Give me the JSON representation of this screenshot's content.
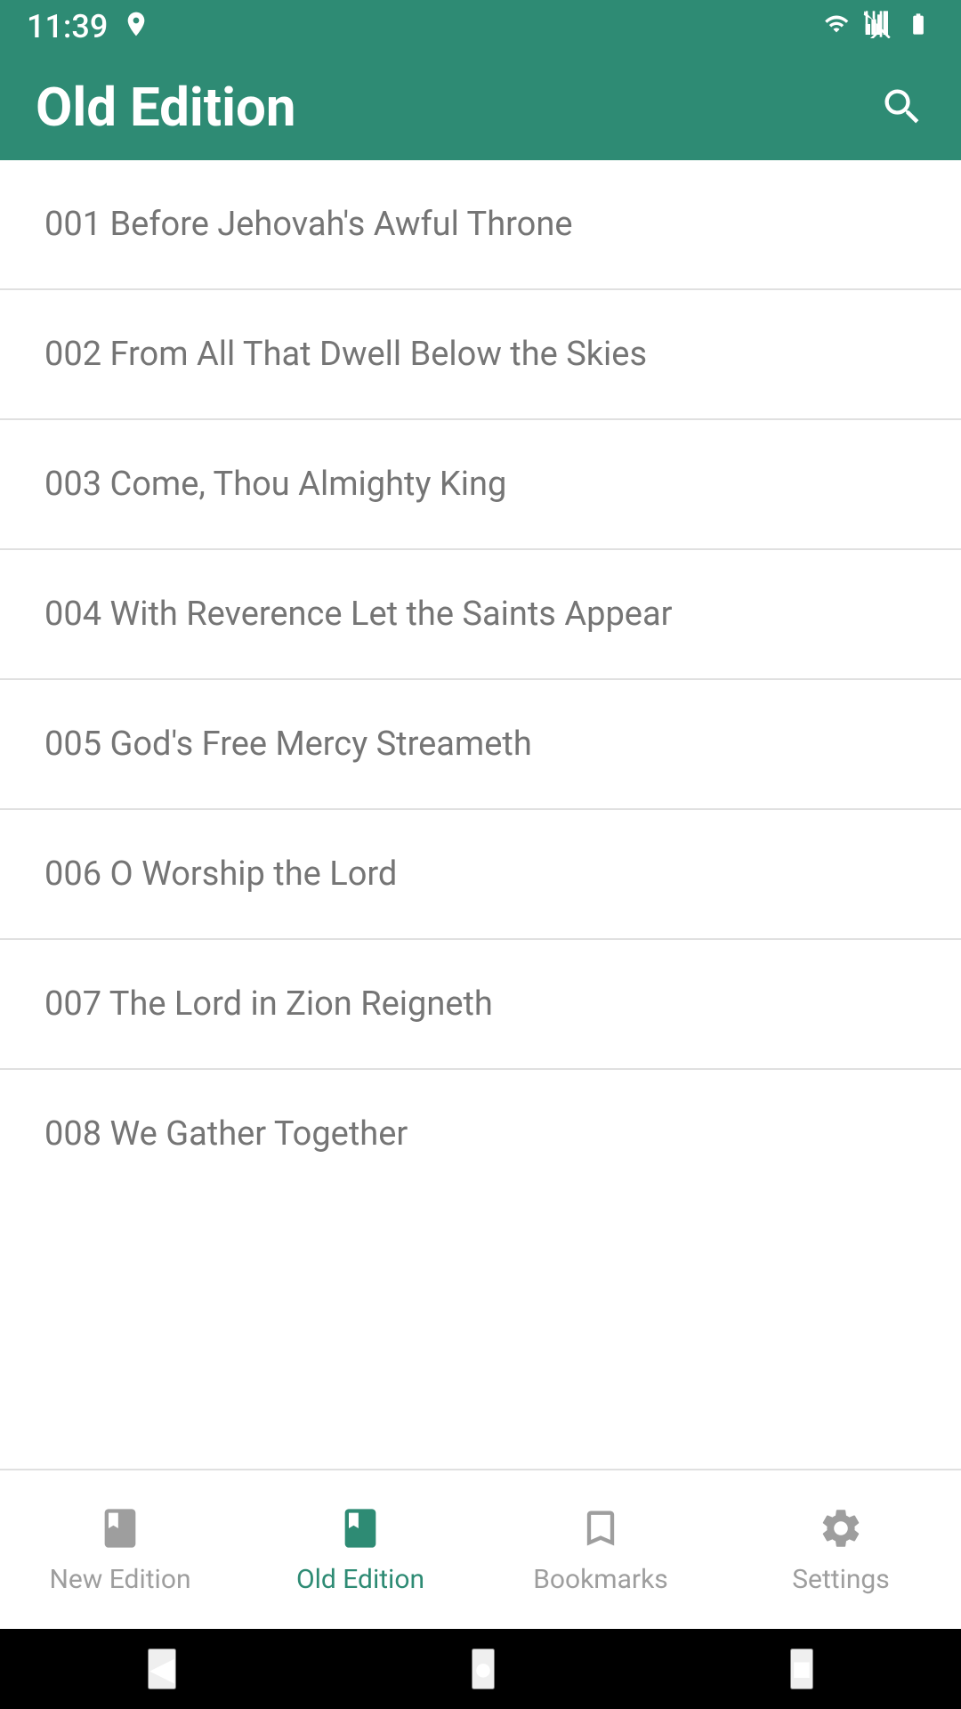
{
  "status": {
    "time": "11:39",
    "icons": [
      "person-pin-icon",
      "wifi-icon",
      "signal-icon",
      "battery-icon"
    ]
  },
  "header": {
    "title": "Old Edition",
    "search_label": "Search"
  },
  "hymns": [
    {
      "number": "001",
      "title": "Before Jehovah's Awful Throne"
    },
    {
      "number": "002",
      "title": "From All That Dwell Below the Skies"
    },
    {
      "number": "003",
      "title": "Come, Thou Almighty King"
    },
    {
      "number": "004",
      "title": "With Reverence Let the Saints Appear"
    },
    {
      "number": "005",
      "title": "God's Free Mercy Streameth"
    },
    {
      "number": "006",
      "title": "O Worship the Lord"
    },
    {
      "number": "007",
      "title": "The Lord in Zion Reigneth"
    },
    {
      "number": "008",
      "title": "We Gather Together"
    }
  ],
  "bottom_nav": {
    "items": [
      {
        "id": "new-edition",
        "label": "New Edition",
        "active": false
      },
      {
        "id": "old-edition",
        "label": "Old Edition",
        "active": true
      },
      {
        "id": "bookmarks",
        "label": "Bookmarks",
        "active": false
      },
      {
        "id": "settings",
        "label": "Settings",
        "active": false
      }
    ]
  },
  "android_nav": {
    "back_label": "◀",
    "home_label": "●",
    "recent_label": "■"
  },
  "colors": {
    "accent": "#2e8b74",
    "text_primary": "#757575",
    "divider": "#e0e0e0",
    "nav_active": "#2e8b74",
    "nav_inactive": "#9e9e9e"
  }
}
